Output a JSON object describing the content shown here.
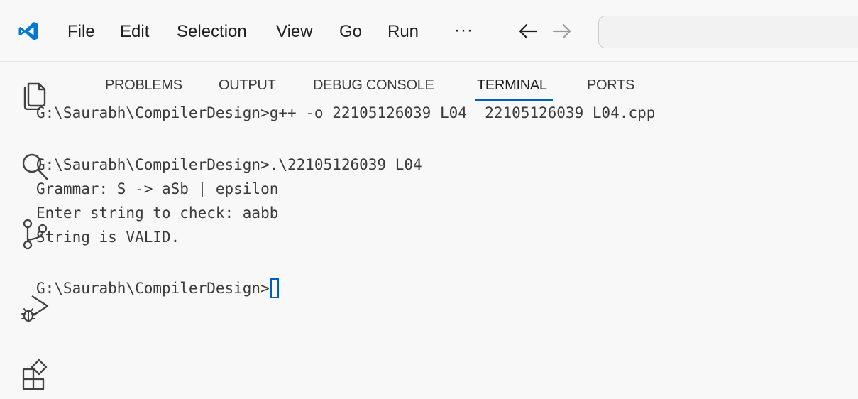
{
  "menu": {
    "file": "File",
    "edit": "Edit",
    "selection": "Selection",
    "view": "View",
    "go": "Go",
    "run": "Run",
    "more": "···"
  },
  "navigation": {
    "back_icon": "arrow-left-icon",
    "forward_icon": "arrow-right-icon"
  },
  "activity_bar": {
    "icons": [
      "explorer-icon",
      "search-icon",
      "source-control-icon",
      "run-debug-icon",
      "extensions-icon"
    ]
  },
  "panel": {
    "tabs": [
      {
        "label": "PROBLEMS"
      },
      {
        "label": "OUTPUT"
      },
      {
        "label": "DEBUG CONSOLE"
      },
      {
        "label": "TERMINAL",
        "active": true
      },
      {
        "label": "PORTS"
      }
    ]
  },
  "terminal": {
    "lines": [
      "G:\\Saurabh\\CompilerDesign>g++ -o 22105126039_L04  22105126039_L04.cpp",
      "G:\\Saurabh\\CompilerDesign>.\\22105126039_L04",
      "Grammar: S -> aSb | epsilon",
      "Enter string to check: aabb",
      "String is VALID.",
      "G:\\Saurabh\\CompilerDesign>"
    ]
  },
  "colors": {
    "accent": "#005fb8",
    "logo": "#0078d4",
    "background": "#f8f8f8",
    "text": "#3b3b3b"
  }
}
